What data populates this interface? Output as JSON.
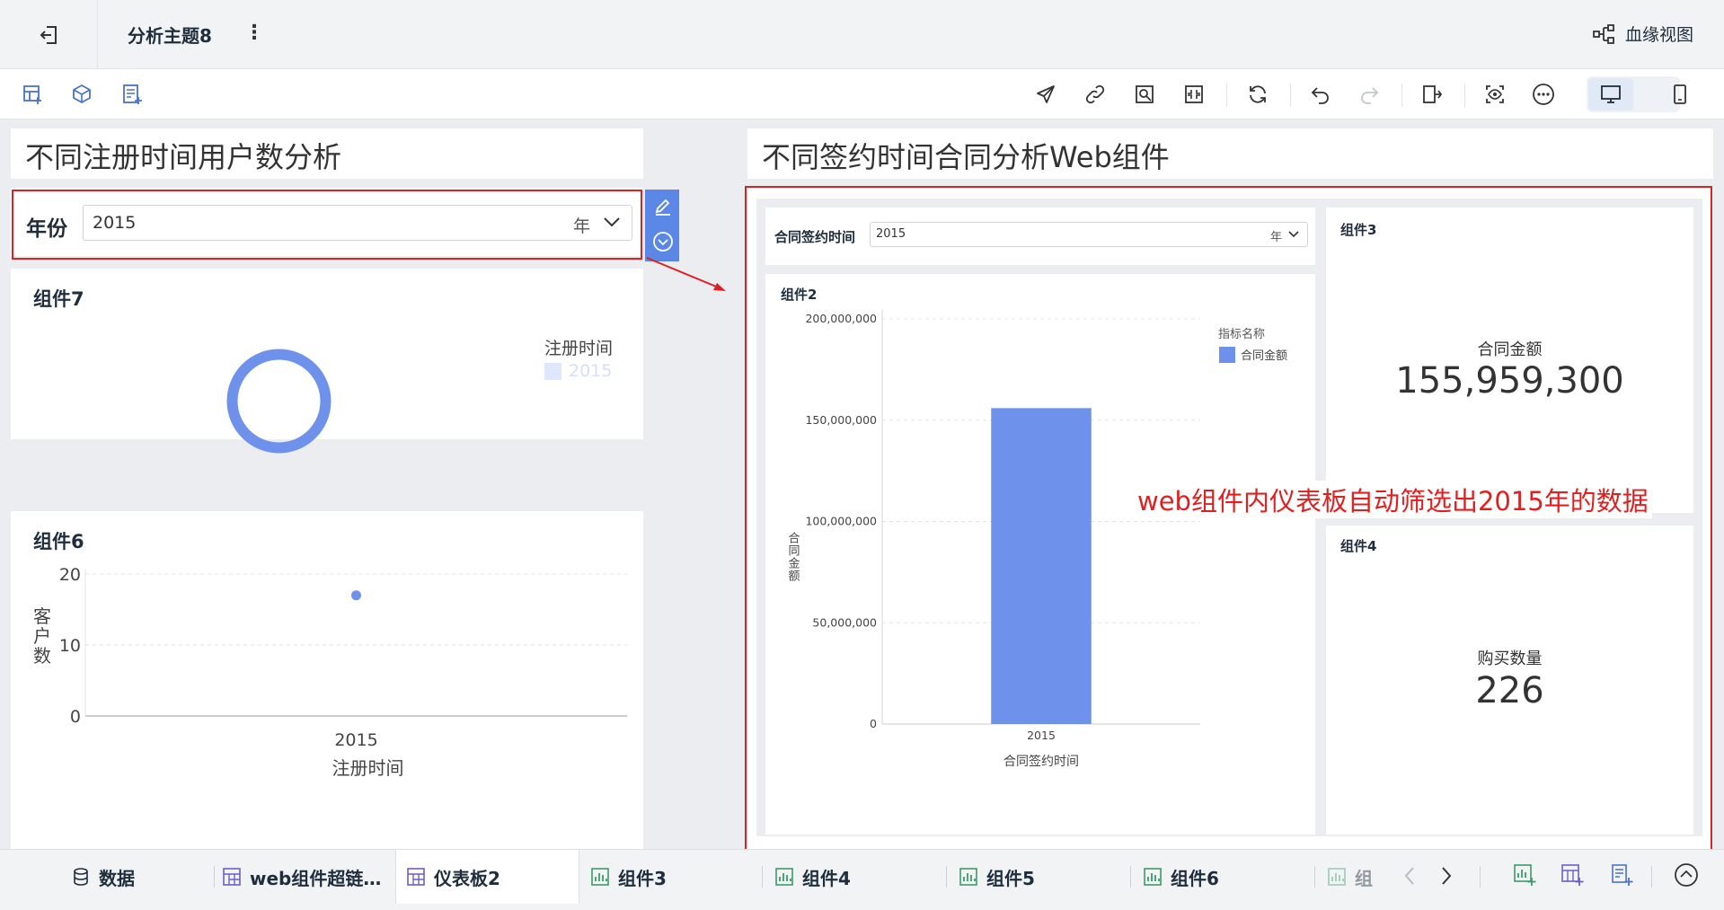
{
  "header": {
    "doc_title": "分析主题8",
    "more_glyph": "⋮",
    "lineage_label": "血缘视图"
  },
  "toolbar": {
    "left_icons": [
      "add-dashboard-icon",
      "add-component-icon",
      "add-report-icon"
    ],
    "right_icons": [
      "send-icon",
      "link-icon",
      "image-search-icon",
      "fit-icon",
      "refresh-icon",
      "undo-icon",
      "redo-icon",
      "export-icon",
      "preview-icon",
      "more-icon",
      "desktop-view-icon",
      "mobile-view-icon"
    ]
  },
  "left_panel": {
    "title": "不同注册时间用户数分析",
    "filter": {
      "label": "年份",
      "value": "2015",
      "unit": "年"
    },
    "card7": {
      "title": "组件7",
      "legend_title": "注册时间",
      "legend_item": "2015",
      "chart_data": {
        "type": "pie",
        "categories": [
          "2015"
        ],
        "values": [
          1
        ],
        "legend_title": "注册时间",
        "legend": "right"
      }
    },
    "card6": {
      "title": "组件6",
      "ylabel": "客户数",
      "xlabel": "注册时间",
      "chart_data": {
        "type": "scatter",
        "x": [
          "2015"
        ],
        "y": [
          17
        ],
        "ylim": [
          0,
          20
        ],
        "yticks": [
          "20",
          "10",
          "0"
        ],
        "xticks": [
          "2015"
        ],
        "xlabel": "注册时间",
        "ylabel": "客户数",
        "grid": true
      }
    }
  },
  "right_panel": {
    "title": "不同签约时间合同分析Web组件",
    "filter": {
      "label": "合同签约时间",
      "value": "2015",
      "unit": "年"
    },
    "card2": {
      "title": "组件2",
      "legend_title": "指标名称",
      "legend_item": "合同金额",
      "ylabel": "合同金额",
      "xlabel": "合同签约时间",
      "chart_data": {
        "type": "bar",
        "categories": [
          "2015"
        ],
        "values": [
          155959300
        ],
        "series": [
          {
            "name": "合同金额",
            "values": [
              155959300
            ]
          }
        ],
        "ylim": [
          0,
          200000000
        ],
        "yticks": [
          "200,000,000",
          "150,000,000",
          "100,000,000",
          "50,000,000",
          "0"
        ],
        "xlabel": "合同签约时间",
        "ylabel": "合同金额",
        "legend_title": "指标名称",
        "legend": "top-right",
        "grid": true
      }
    },
    "card3": {
      "title": "组件3",
      "kpi_label": "合同金额",
      "kpi_value": "155,959,300"
    },
    "card4": {
      "title": "组件4",
      "kpi_label": "购买数量",
      "kpi_value": "226"
    },
    "annotation": "web组件内仪表板自动筛选出2015年的数据"
  },
  "bottom_tabs": [
    {
      "label": "数据",
      "icon": "database-icon"
    },
    {
      "label": "web组件超链…",
      "icon": "dashboard-icon"
    },
    {
      "label": "仪表板2",
      "icon": "dashboard-icon",
      "active": true
    },
    {
      "label": "组件3",
      "icon": "chart-icon"
    },
    {
      "label": "组件4",
      "icon": "chart-icon"
    },
    {
      "label": "组件5",
      "icon": "chart-icon"
    },
    {
      "label": "组件6",
      "icon": "chart-icon"
    },
    {
      "label": "组",
      "icon": "chart-icon"
    }
  ],
  "colors": {
    "accent": "#6e92eb",
    "annotation_red": "#e02020",
    "legend_light": "#dfe7fb",
    "edit_side_button": "#5b87e6"
  }
}
